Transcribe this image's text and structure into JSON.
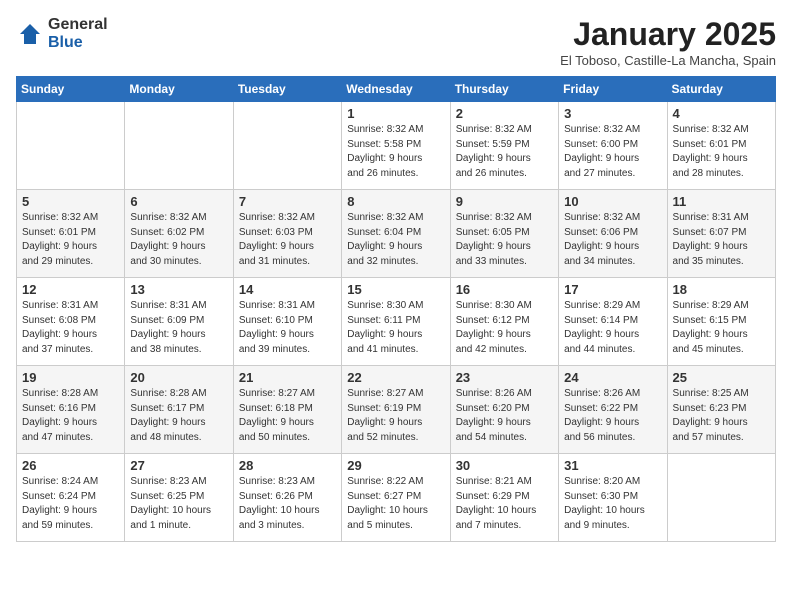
{
  "logo": {
    "general": "General",
    "blue": "Blue"
  },
  "title": "January 2025",
  "subtitle": "El Toboso, Castille-La Mancha, Spain",
  "weekdays": [
    "Sunday",
    "Monday",
    "Tuesday",
    "Wednesday",
    "Thursday",
    "Friday",
    "Saturday"
  ],
  "weeks": [
    [
      {
        "num": "",
        "info": ""
      },
      {
        "num": "",
        "info": ""
      },
      {
        "num": "",
        "info": ""
      },
      {
        "num": "1",
        "info": "Sunrise: 8:32 AM\nSunset: 5:58 PM\nDaylight: 9 hours\nand 26 minutes."
      },
      {
        "num": "2",
        "info": "Sunrise: 8:32 AM\nSunset: 5:59 PM\nDaylight: 9 hours\nand 26 minutes."
      },
      {
        "num": "3",
        "info": "Sunrise: 8:32 AM\nSunset: 6:00 PM\nDaylight: 9 hours\nand 27 minutes."
      },
      {
        "num": "4",
        "info": "Sunrise: 8:32 AM\nSunset: 6:01 PM\nDaylight: 9 hours\nand 28 minutes."
      }
    ],
    [
      {
        "num": "5",
        "info": "Sunrise: 8:32 AM\nSunset: 6:01 PM\nDaylight: 9 hours\nand 29 minutes."
      },
      {
        "num": "6",
        "info": "Sunrise: 8:32 AM\nSunset: 6:02 PM\nDaylight: 9 hours\nand 30 minutes."
      },
      {
        "num": "7",
        "info": "Sunrise: 8:32 AM\nSunset: 6:03 PM\nDaylight: 9 hours\nand 31 minutes."
      },
      {
        "num": "8",
        "info": "Sunrise: 8:32 AM\nSunset: 6:04 PM\nDaylight: 9 hours\nand 32 minutes."
      },
      {
        "num": "9",
        "info": "Sunrise: 8:32 AM\nSunset: 6:05 PM\nDaylight: 9 hours\nand 33 minutes."
      },
      {
        "num": "10",
        "info": "Sunrise: 8:32 AM\nSunset: 6:06 PM\nDaylight: 9 hours\nand 34 minutes."
      },
      {
        "num": "11",
        "info": "Sunrise: 8:31 AM\nSunset: 6:07 PM\nDaylight: 9 hours\nand 35 minutes."
      }
    ],
    [
      {
        "num": "12",
        "info": "Sunrise: 8:31 AM\nSunset: 6:08 PM\nDaylight: 9 hours\nand 37 minutes."
      },
      {
        "num": "13",
        "info": "Sunrise: 8:31 AM\nSunset: 6:09 PM\nDaylight: 9 hours\nand 38 minutes."
      },
      {
        "num": "14",
        "info": "Sunrise: 8:31 AM\nSunset: 6:10 PM\nDaylight: 9 hours\nand 39 minutes."
      },
      {
        "num": "15",
        "info": "Sunrise: 8:30 AM\nSunset: 6:11 PM\nDaylight: 9 hours\nand 41 minutes."
      },
      {
        "num": "16",
        "info": "Sunrise: 8:30 AM\nSunset: 6:12 PM\nDaylight: 9 hours\nand 42 minutes."
      },
      {
        "num": "17",
        "info": "Sunrise: 8:29 AM\nSunset: 6:14 PM\nDaylight: 9 hours\nand 44 minutes."
      },
      {
        "num": "18",
        "info": "Sunrise: 8:29 AM\nSunset: 6:15 PM\nDaylight: 9 hours\nand 45 minutes."
      }
    ],
    [
      {
        "num": "19",
        "info": "Sunrise: 8:28 AM\nSunset: 6:16 PM\nDaylight: 9 hours\nand 47 minutes."
      },
      {
        "num": "20",
        "info": "Sunrise: 8:28 AM\nSunset: 6:17 PM\nDaylight: 9 hours\nand 48 minutes."
      },
      {
        "num": "21",
        "info": "Sunrise: 8:27 AM\nSunset: 6:18 PM\nDaylight: 9 hours\nand 50 minutes."
      },
      {
        "num": "22",
        "info": "Sunrise: 8:27 AM\nSunset: 6:19 PM\nDaylight: 9 hours\nand 52 minutes."
      },
      {
        "num": "23",
        "info": "Sunrise: 8:26 AM\nSunset: 6:20 PM\nDaylight: 9 hours\nand 54 minutes."
      },
      {
        "num": "24",
        "info": "Sunrise: 8:26 AM\nSunset: 6:22 PM\nDaylight: 9 hours\nand 56 minutes."
      },
      {
        "num": "25",
        "info": "Sunrise: 8:25 AM\nSunset: 6:23 PM\nDaylight: 9 hours\nand 57 minutes."
      }
    ],
    [
      {
        "num": "26",
        "info": "Sunrise: 8:24 AM\nSunset: 6:24 PM\nDaylight: 9 hours\nand 59 minutes."
      },
      {
        "num": "27",
        "info": "Sunrise: 8:23 AM\nSunset: 6:25 PM\nDaylight: 10 hours\nand 1 minute."
      },
      {
        "num": "28",
        "info": "Sunrise: 8:23 AM\nSunset: 6:26 PM\nDaylight: 10 hours\nand 3 minutes."
      },
      {
        "num": "29",
        "info": "Sunrise: 8:22 AM\nSunset: 6:27 PM\nDaylight: 10 hours\nand 5 minutes."
      },
      {
        "num": "30",
        "info": "Sunrise: 8:21 AM\nSunset: 6:29 PM\nDaylight: 10 hours\nand 7 minutes."
      },
      {
        "num": "31",
        "info": "Sunrise: 8:20 AM\nSunset: 6:30 PM\nDaylight: 10 hours\nand 9 minutes."
      },
      {
        "num": "",
        "info": ""
      }
    ]
  ]
}
